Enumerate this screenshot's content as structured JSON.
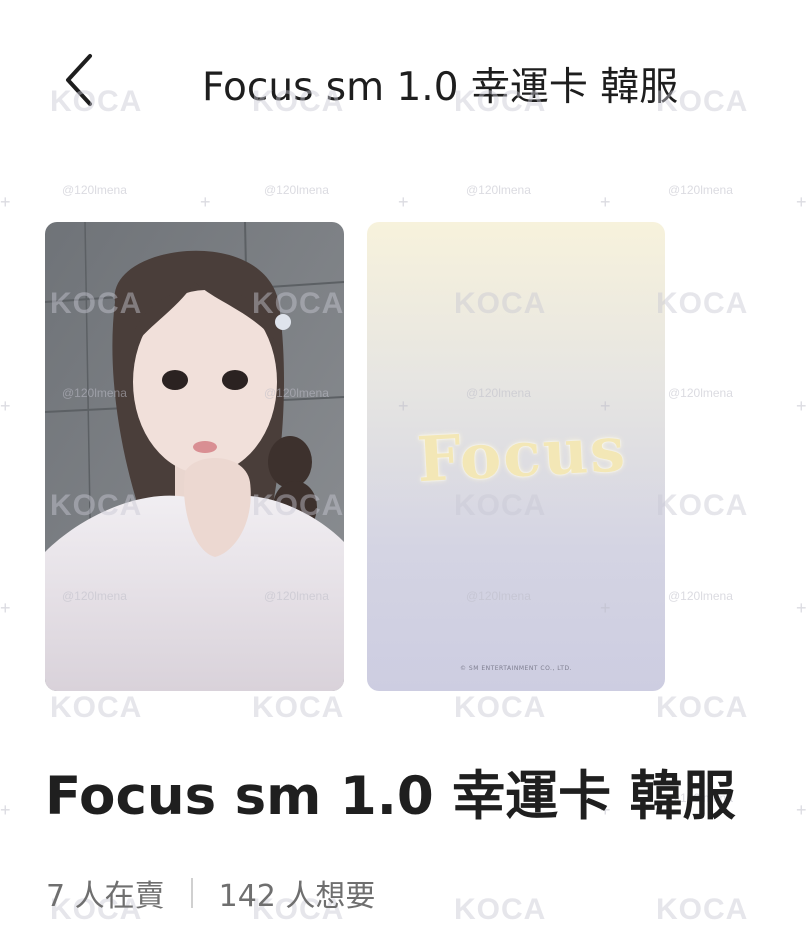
{
  "header": {
    "title": "Focus sm 1.0 幸運卡 韓服",
    "back_icon": "chevron-left-icon"
  },
  "cards": {
    "front_alt": "idol photocard front",
    "back_logo": "Focus",
    "back_copyright": "© SM ENTERTAINMENT CO., LTD."
  },
  "product": {
    "title": "Focus sm 1.0 幸運卡 韓服"
  },
  "stats": {
    "selling": "7 人在賣",
    "wanting": "142 人想要"
  },
  "watermarks": {
    "brand": "KOCA",
    "handle": "@120lmena"
  },
  "colors": {
    "text": "#1e1e1e",
    "muted": "#6f6f6f"
  }
}
